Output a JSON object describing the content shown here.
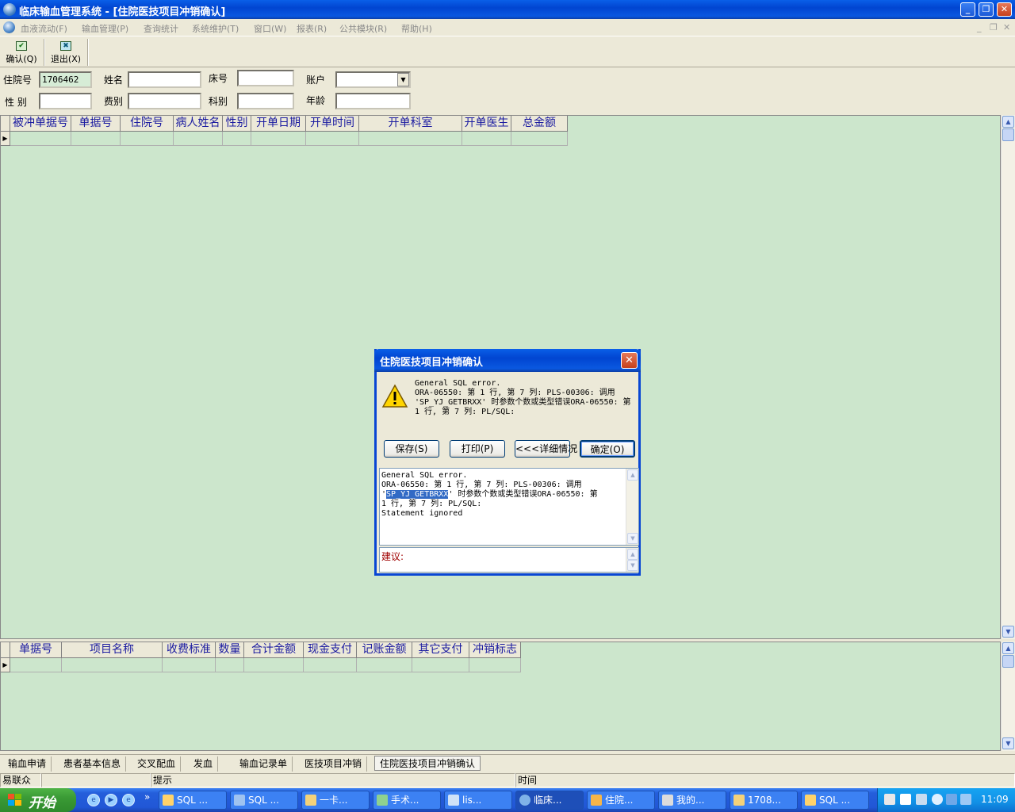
{
  "window": {
    "title": "临床输血管理系统 - [住院医技项目冲销确认]",
    "controls": {
      "minimize": "_",
      "restore": "❐",
      "close": "✕"
    }
  },
  "menu": {
    "items": [
      "血液流动(F)",
      "输血管理(P)",
      "查询统计",
      "系统维护(T)",
      "窗口(W)",
      "报表(R)",
      "公共模块(R)",
      "帮助(H)"
    ],
    "mdi_controls": [
      "_",
      "❐",
      "✕"
    ]
  },
  "toolbar": {
    "confirm_label": "确认(Q)",
    "exit_label": "退出(X)",
    "confirm_icon": "✔",
    "exit_icon": "✖"
  },
  "form": {
    "admission_no_label": "住院号",
    "admission_no_value": "1706462",
    "name_label": "姓名",
    "name_value": "",
    "bed_label": "床号",
    "bed_value": "",
    "account_label": "账户",
    "account_value": "",
    "gender_label": "性 别",
    "gender_value": "",
    "fee_type_label": "费别",
    "fee_type_value": "",
    "dept_label": "科别",
    "dept_value": "",
    "age_label": "年龄",
    "age_value": ""
  },
  "top_grid": {
    "columns": [
      "被冲单据号",
      "单据号",
      "住院号",
      "病人姓名",
      "性别",
      "开单日期",
      "开单时间",
      "开单科室",
      "开单医生",
      "总金额"
    ]
  },
  "bottom_grid": {
    "columns": [
      "单据号",
      "项目名称",
      "收费标准",
      "数量",
      "合计金额",
      "现金支付",
      "记账金额",
      "其它支付",
      "冲销标志"
    ]
  },
  "scroll": {
    "up": "▲",
    "down": "▼",
    "row_pointer": "▶"
  },
  "tabs": [
    "输血申请",
    "患者基本信息",
    "交叉配血",
    "发血",
    "输血记录单",
    "医技项目冲销",
    "住院医技项目冲销确认"
  ],
  "active_tab": "住院医技项目冲销确认",
  "statusbar": {
    "user": "易联众",
    "hint_label": "提示",
    "time_label": "时间"
  },
  "dialog": {
    "title": "住院医技项目冲销确认",
    "close": "✕",
    "message": "General SQL error.\nORA-06550: 第 1 行, 第 7 列: PLS-00306: 调用\n'SP_YJ_GETBRXX' 时参数个数或类型错误ORA-06550: 第 1 行, 第 7 列: PL/SQL:",
    "buttons": {
      "save": "保存(S)",
      "print": "打印(P)",
      "details": "<<<详细情况",
      "ok": "确定(O)"
    },
    "detail_line1": "General SQL error.",
    "detail_line2": "ORA-06550: 第 1 行, 第 7 列: PLS-00306: 调用",
    "detail_quote": "'",
    "detail_highlight": "SP_YJ_GETBRXX",
    "detail_line3_rest": "' 时参数个数或类型错误ORA-06550: 第",
    "detail_line4": "1 行, 第 7 列: PL/SQL:",
    "detail_line5": "Statement ignored",
    "suggestion_label": "建议:"
  },
  "taskbar": {
    "start_label": "开始",
    "quicklaunch_more": "»",
    "tasks": [
      "SQL ...",
      "SQL ...",
      "一卡...",
      "手术...",
      "lis...",
      "临床...",
      "住院...",
      "我的...",
      "1708...",
      "SQL ..."
    ],
    "active_task": "临床...",
    "clock": "11:09"
  },
  "colors": {
    "grid_background": "#cce6cc",
    "title_blue": "#0145d1",
    "header_text": "#1a1aa0",
    "highlight": "#316ac5"
  }
}
